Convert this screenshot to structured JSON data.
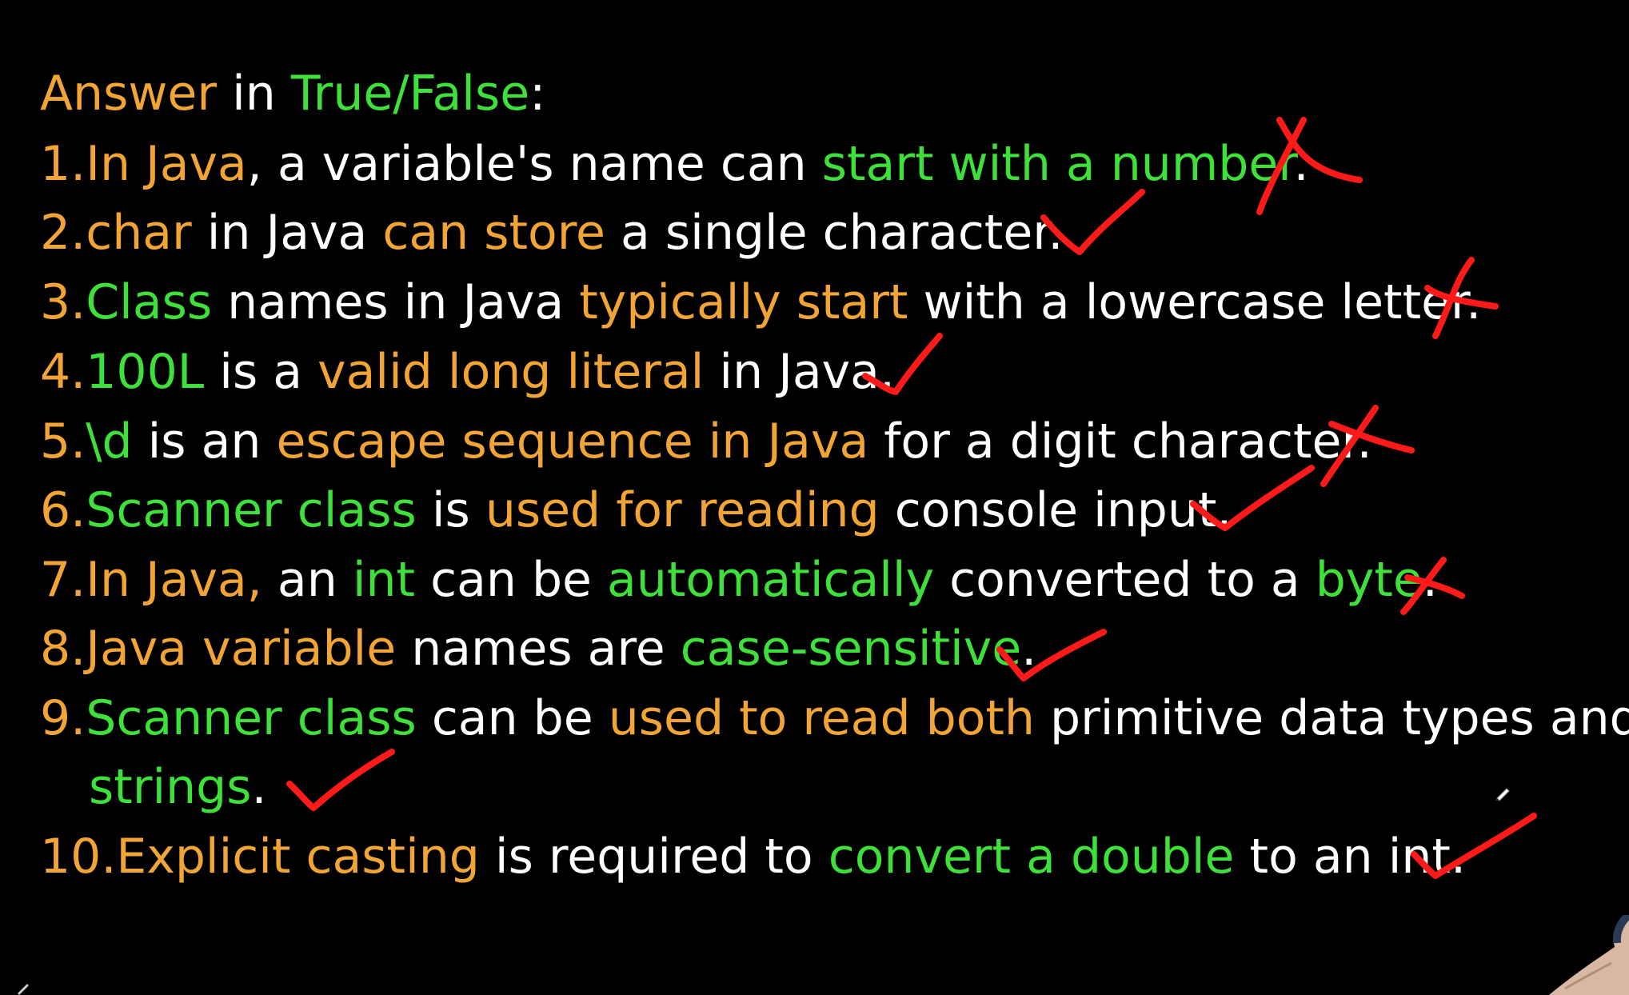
{
  "heading": [
    {
      "text": "Answer",
      "color": "orange"
    },
    {
      "text": " in ",
      "color": "white"
    },
    {
      "text": "True/False",
      "color": "green"
    },
    {
      "text": ":",
      "color": "white"
    }
  ],
  "questions": [
    {
      "number": "1.",
      "segments": [
        {
          "text": "In Java",
          "color": "orange"
        },
        {
          "text": ", a variable's name can ",
          "color": "white"
        },
        {
          "text": "start with a number",
          "color": "green"
        },
        {
          "text": ".",
          "color": "white"
        }
      ],
      "mark": "cross-icon"
    },
    {
      "number": "2.",
      "segments": [
        {
          "text": "char",
          "color": "orange"
        },
        {
          "text": " in Java ",
          "color": "white"
        },
        {
          "text": "can store",
          "color": "orange"
        },
        {
          "text": " a single character.",
          "color": "white"
        }
      ],
      "mark": "check-icon"
    },
    {
      "number": "3.",
      "segments": [
        {
          "text": "Class",
          "color": "green"
        },
        {
          "text": " names in Java ",
          "color": "white"
        },
        {
          "text": "typically start",
          "color": "orange"
        },
        {
          "text": " with a lowercase letter.",
          "color": "white"
        }
      ],
      "mark": "cross-icon"
    },
    {
      "number": "4.",
      "segments": [
        {
          "text": "100L",
          "color": "green"
        },
        {
          "text": " is a ",
          "color": "white"
        },
        {
          "text": "valid long literal",
          "color": "orange"
        },
        {
          "text": " in Java.",
          "color": "white"
        }
      ],
      "mark": "check-icon"
    },
    {
      "number": "5.",
      "segments": [
        {
          "text": "\\d",
          "color": "green"
        },
        {
          "text": " is an ",
          "color": "white"
        },
        {
          "text": "escape sequence in Java",
          "color": "orange"
        },
        {
          "text": " for a digit character.",
          "color": "white"
        }
      ],
      "mark": "cross-icon"
    },
    {
      "number": "6.",
      "segments": [
        {
          "text": "Scanner class",
          "color": "green"
        },
        {
          "text": " is ",
          "color": "white"
        },
        {
          "text": "used for reading",
          "color": "orange"
        },
        {
          "text": " console input.",
          "color": "white"
        }
      ],
      "mark": "check-icon"
    },
    {
      "number": "7.",
      "segments": [
        {
          "text": "In Java,",
          "color": "orange"
        },
        {
          "text": " an ",
          "color": "white"
        },
        {
          "text": "int",
          "color": "green"
        },
        {
          "text": " can be ",
          "color": "white"
        },
        {
          "text": "automatically",
          "color": "green"
        },
        {
          "text": " converted to a ",
          "color": "white"
        },
        {
          "text": "byte",
          "color": "green"
        },
        {
          "text": ".",
          "color": "white"
        }
      ],
      "mark": "cross-icon"
    },
    {
      "number": "8.",
      "segments": [
        {
          "text": "Java variable",
          "color": "orange"
        },
        {
          "text": " names are ",
          "color": "white"
        },
        {
          "text": "case-sensitive",
          "color": "green"
        },
        {
          "text": ".",
          "color": "white"
        }
      ],
      "mark": "check-icon"
    },
    {
      "number": "9.",
      "segments": [
        {
          "text": "Scanner class",
          "color": "green"
        },
        {
          "text": " can be ",
          "color": "white"
        },
        {
          "text": "used to read both",
          "color": "orange"
        },
        {
          "text": " primitive data types and",
          "color": "white"
        }
      ],
      "continuation": [
        {
          "text": "strings",
          "color": "green"
        },
        {
          "text": ".",
          "color": "white"
        }
      ],
      "mark": "check-icon"
    },
    {
      "number": "10.",
      "segments": [
        {
          "text": "Explicit casting",
          "color": "orange"
        },
        {
          "text": " is required to ",
          "color": "white"
        },
        {
          "text": "convert a double",
          "color": "green"
        },
        {
          "text": " to an int.",
          "color": "white"
        }
      ],
      "mark": "check-icon"
    }
  ],
  "colors": {
    "orange": "#f2a534",
    "green": "#3ee03a",
    "white": "#ffffff",
    "annotation_red": "#ff1a1a",
    "background": "#000000"
  },
  "icons": {
    "pen_cursor": "pen-cursor-icon",
    "presenter_hand": "presenter-hand"
  }
}
